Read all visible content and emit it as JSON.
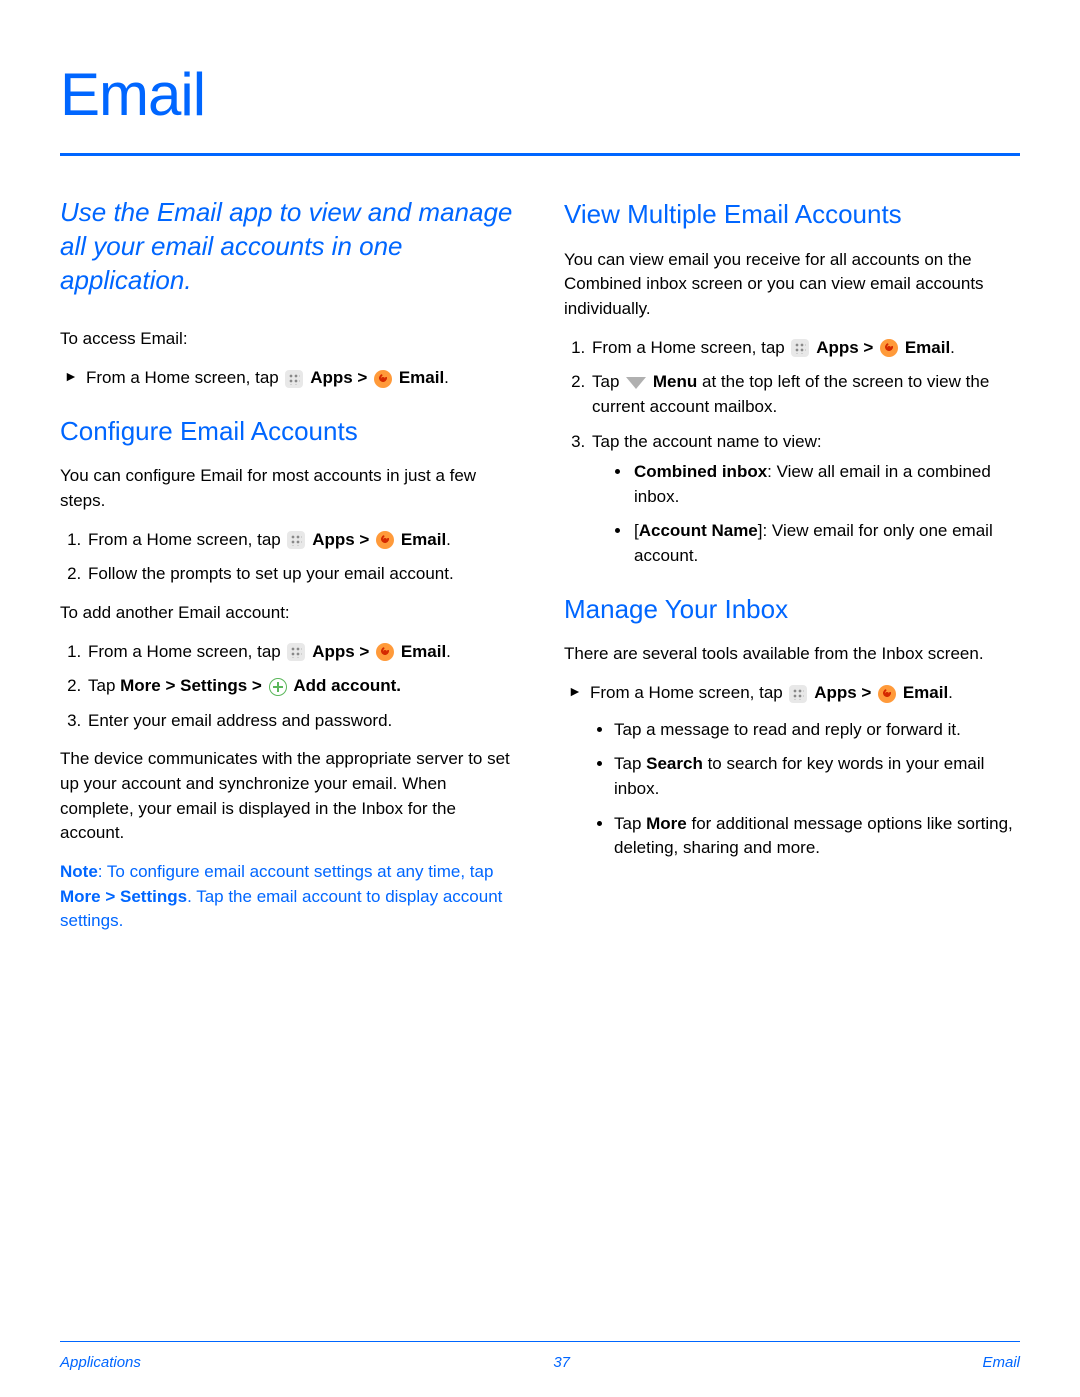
{
  "page": {
    "title": "Email"
  },
  "left": {
    "intro": "Use the Email app to view and manage all your email accounts in one application.",
    "access_label": "To access Email:",
    "access_step_prefix": "From a Home screen, tap ",
    "apps_label": "Apps",
    "email_label": "Email",
    "h_configure": "Configure Email Accounts",
    "configure_intro": "You can configure Email for most accounts in just a few steps.",
    "config_step1_prefix": "From a Home screen, tap ",
    "config_step2": "Follow the prompts to set up your email account.",
    "add_label": "To add another Email account:",
    "add_step1_prefix": "From a Home screen, tap ",
    "add_step2_prefix": "Tap ",
    "more_path": "More > Settings > ",
    "add_account_label": "Add account",
    "add_step3": "Enter your email address and password.",
    "sync_para": "The device communicates with the appropriate server to set up your account and synchronize your email. When complete, your email is displayed in the Inbox for the account.",
    "note_prefix": "Note",
    "note_mid1": ": To configure email account settings at any time, tap ",
    "note_bold": "More > Settings",
    "note_mid2": ". Tap the email account to display account settings."
  },
  "right": {
    "h_view": "View Multiple Email Accounts",
    "view_intro": "You can view email you receive for all accounts on the Combined inbox screen or you can view email accounts individually.",
    "view_step1_prefix": "From a Home screen, tap ",
    "view_step2_prefix": "Tap ",
    "menu_label": "Menu",
    "view_step2_suffix": " at the top left of the screen to view the current account mailbox.",
    "view_step3": "Tap the account name to view:",
    "combined_label": "Combined inbox",
    "combined_text": ": View all email in a combined inbox.",
    "account_name_label": "Account Name",
    "account_name_text": "]: View email for only one email account.",
    "h_manage": "Manage Your Inbox",
    "manage_intro": "There are several tools available from the Inbox screen.",
    "manage_step_prefix": "From a Home screen, tap ",
    "manage_b1": "Tap a message to read and reply or forward it.",
    "manage_b2_prefix": "Tap ",
    "manage_b2_bold": "Search",
    "manage_b2_suffix": " to search for key words in your email inbox.",
    "manage_b3_prefix": "Tap ",
    "manage_b3_bold": "More",
    "manage_b3_suffix": " for additional message options like sorting, deleting, sharing and more."
  },
  "footer": {
    "left": "Applications",
    "center": "37",
    "right": "Email"
  }
}
